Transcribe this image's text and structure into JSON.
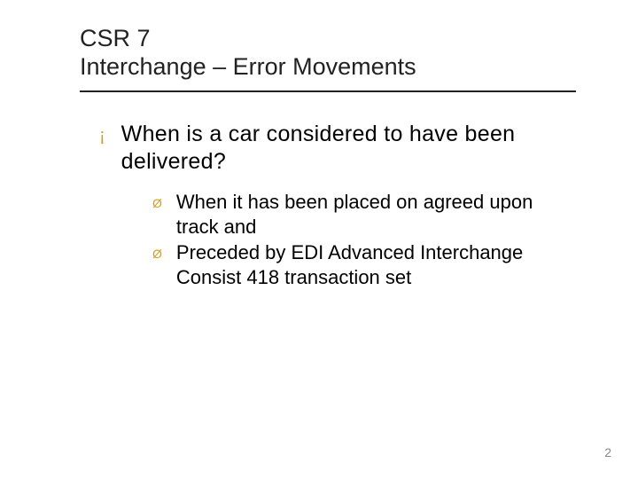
{
  "title": {
    "line1": "CSR 7",
    "line2": "Interchange – Error Movements"
  },
  "level1": {
    "marker": "¡",
    "text": "When is a car considered to have been delivered?"
  },
  "level2": [
    {
      "marker": "Ø",
      "text": "When it has been placed on agreed upon track   and"
    },
    {
      "marker": "Ø",
      "text": "Preceded by EDI Advanced Interchange Consist 418 transaction set"
    }
  ],
  "page_number": "2"
}
